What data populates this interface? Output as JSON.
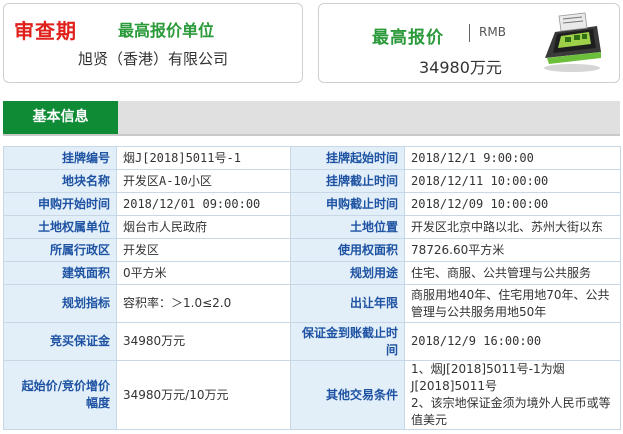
{
  "header": {
    "status_label": "审查期",
    "highest_bid_unit_title": "最高报价单位",
    "highest_bid_unit_name": "旭贤（香港）有限公司",
    "highest_price_title": "最高报价",
    "currency": "RMB",
    "highest_price_value": "34980万元",
    "machine_icon": "bidding-terminal-icon"
  },
  "tabs": {
    "basic_info": "基本信息"
  },
  "table": {
    "rows": [
      {
        "l1": "挂牌编号",
        "v1": "烟J[2018]5011号-1",
        "l2": "挂牌起始时间",
        "v2": "2018/12/1 9:00:00"
      },
      {
        "l1": "地块名称",
        "v1": "开发区A-10小区",
        "l2": "挂牌截止时间",
        "v2": "2018/12/11 10:00:00"
      },
      {
        "l1": "申购开始时间",
        "v1": "2018/12/01 09:00:00",
        "l2": "申购截止时间",
        "v2": "2018/12/09 10:00:00"
      },
      {
        "l1": "土地权属单位",
        "v1": "烟台市人民政府",
        "l2": "土地位置",
        "v2": "开发区北京中路以北、苏州大街以东"
      },
      {
        "l1": "所属行政区",
        "v1": "开发区",
        "l2": "使用权面积",
        "v2": "78726.60平方米"
      },
      {
        "l1": "建筑面积",
        "v1": "0平方米",
        "l2": "规划用途",
        "v2": "住宅、商服、公共管理与公共服务"
      },
      {
        "l1": "规划指标",
        "v1": "容积率：＞1.0≤2.0",
        "l2": "出让年限",
        "v2": "商服用地40年、住宅用地70年、公共管理与公共服务用地50年"
      },
      {
        "l1": "竞买保证金",
        "v1": "34980万元",
        "l2": "保证金到账截止时间",
        "v2": "2018/12/9 16:00:00"
      },
      {
        "l1": "起始价/竞价增价幅度",
        "v1": "34980万元/10万元",
        "l2": "其他交易条件",
        "v2": "1、烟J[2018]5011号-1为烟J[2018]5011号\n2、该宗地保证金须为境外人民币或等值美元"
      }
    ]
  }
}
